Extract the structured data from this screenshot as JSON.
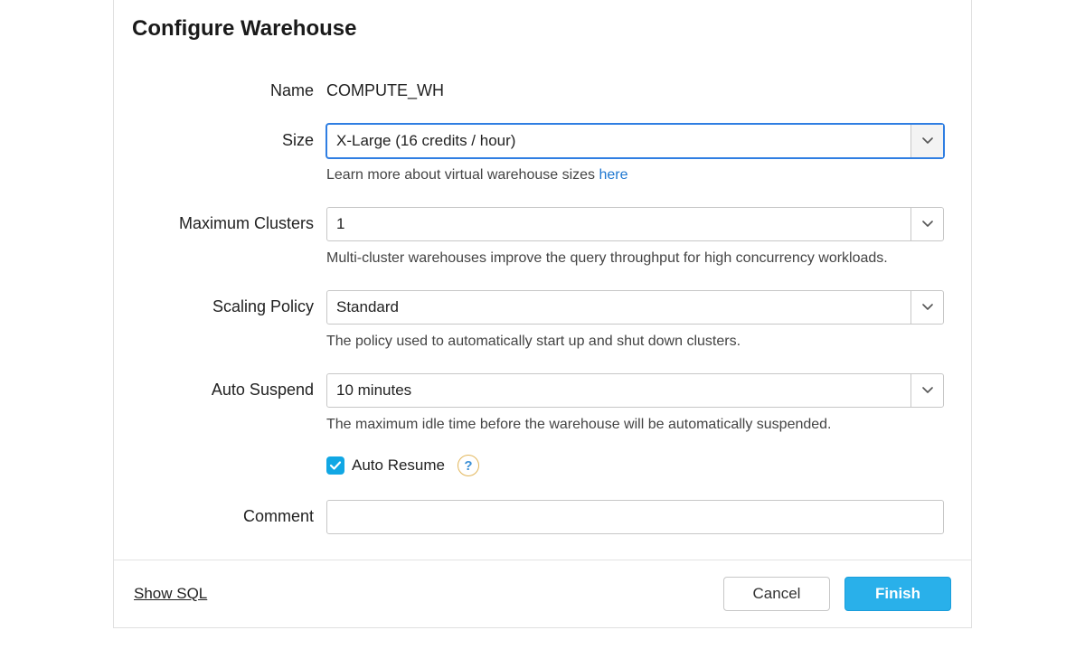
{
  "dialog": {
    "title": "Configure Warehouse"
  },
  "fields": {
    "name": {
      "label": "Name",
      "value": "COMPUTE_WH"
    },
    "size": {
      "label": "Size",
      "value": "X-Large  (16 credits / hour)",
      "helper_pre": "Learn more about virtual warehouse sizes ",
      "helper_link": "here"
    },
    "max_clusters": {
      "label": "Maximum Clusters",
      "value": "1",
      "helper": "Multi-cluster warehouses improve the query throughput for high concurrency workloads."
    },
    "scaling_policy": {
      "label": "Scaling Policy",
      "value": "Standard",
      "helper": "The policy used to automatically start up and shut down clusters."
    },
    "auto_suspend": {
      "label": "Auto Suspend",
      "value": "10 minutes",
      "helper": "The maximum idle time before the warehouse will be automatically suspended."
    },
    "auto_resume": {
      "label": "Auto Resume",
      "checked": true,
      "help_glyph": "?"
    },
    "comment": {
      "label": "Comment",
      "value": ""
    }
  },
  "footer": {
    "show_sql": "Show SQL",
    "cancel": "Cancel",
    "finish": "Finish"
  }
}
